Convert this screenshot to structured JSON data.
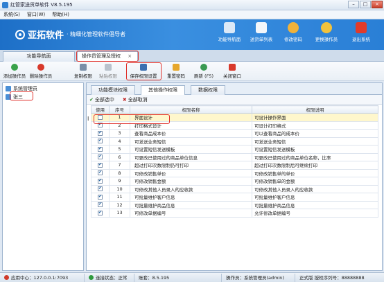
{
  "window": {
    "title": "红管家送货单软件 V8.5.195",
    "controls": [
      "–",
      "□",
      "×"
    ]
  },
  "menu": [
    "系统(S)",
    "窗口(W)",
    "帮助(H)"
  ],
  "banner": {
    "brand": "亚拓软件",
    "slogan": "· 精细化管理软件倡导者",
    "buttons": [
      {
        "label": "功能导航面",
        "icon": "monitor-icon",
        "color": "#dce9f7"
      },
      {
        "label": "送货单列表",
        "icon": "list-icon",
        "color": "#f3f6fa"
      },
      {
        "label": "修改密码",
        "icon": "user-key-icon",
        "color": "#f0b23a"
      },
      {
        "label": "更换操作员",
        "icon": "users-icon",
        "color": "#f2c23c"
      },
      {
        "label": "退出系统",
        "icon": "power-icon",
        "color": "#e23a2a"
      }
    ]
  },
  "tabs": [
    {
      "label": "功能导航面"
    },
    {
      "label": "操作员管理及授权",
      "close": "×"
    }
  ],
  "toolbar": [
    {
      "label": "添加操作员",
      "icon": "add-icon",
      "color": "#3aa24a",
      "enabled": true
    },
    {
      "label": "删除操作员",
      "icon": "delete-icon",
      "color": "#d8392b",
      "enabled": true
    },
    {
      "label": "复制权限",
      "icon": "copy-icon",
      "color": "#7a8fa8",
      "enabled": true
    },
    {
      "label": "粘贴权限",
      "icon": "paste-icon",
      "color": "#b9c2cc",
      "enabled": false
    },
    {
      "label": "保存权限设置",
      "icon": "save-icon",
      "color": "#3c6fb0",
      "enabled": true
    },
    {
      "label": "重置密码",
      "icon": "key-icon",
      "color": "#e6a72c",
      "enabled": true
    },
    {
      "label": "刷新 (F5)",
      "icon": "refresh-icon",
      "color": "#3a9a52",
      "enabled": true
    },
    {
      "label": "关闭窗口",
      "icon": "close-icon",
      "color": "#d8392b",
      "enabled": true
    }
  ],
  "tree": [
    "系统管理员",
    "张三"
  ],
  "subtabs": [
    "功能模块权限",
    "其他操作权限",
    "数据权限"
  ],
  "selbar": {
    "select_all": "全部选中",
    "clear_all": "全部取消"
  },
  "columns": [
    "使用",
    "序号",
    "权限名称",
    "权限说明"
  ],
  "rows": [
    {
      "checked": false,
      "no": "1",
      "name": "界面设计",
      "desc": "可设计操作界面"
    },
    {
      "checked": true,
      "no": "2",
      "name": "打印格式设计",
      "desc": "可设计打印格式"
    },
    {
      "checked": true,
      "no": "3",
      "name": "查看商品成本价",
      "desc": "可以查看商品的成本价"
    },
    {
      "checked": true,
      "no": "4",
      "name": "可发送业务短信",
      "desc": "可发送业务短信"
    },
    {
      "checked": true,
      "no": "5",
      "name": "可设置短信发送模板",
      "desc": "可设置短信发送模板"
    },
    {
      "checked": true,
      "no": "6",
      "name": "可更改已使用过的商品单位信息",
      "desc": "可更改已使用过的商品单位名称，比率"
    },
    {
      "checked": true,
      "no": "7",
      "name": "超过打印次数限制仍可打印",
      "desc": "超过打印次数限制后可继续打印"
    },
    {
      "checked": true,
      "no": "8",
      "name": "可修改销售单价",
      "desc": "可修改销售单的单价"
    },
    {
      "checked": true,
      "no": "9",
      "name": "可修改销售金额",
      "desc": "可修改销售单的金额"
    },
    {
      "checked": true,
      "no": "10",
      "name": "可修改其他人员录入的应收款",
      "desc": "可修改其他人员录入的应收款"
    },
    {
      "checked": true,
      "no": "11",
      "name": "可批量维护客户信息",
      "desc": "可批量维护客户信息"
    },
    {
      "checked": true,
      "no": "12",
      "name": "可批量维护商品信息",
      "desc": "可批量维护商品信息"
    },
    {
      "checked": true,
      "no": "13",
      "name": "可修改单据编号",
      "desc": "允许修改单据编号"
    }
  ],
  "cursor_mark": "I",
  "status": {
    "app_center": "应用中心：127.0.0.1:7093",
    "connection": "连接状态：正常",
    "account": "账套：8.5.195",
    "operator": "操作员：系统管理员(admin)",
    "license": "正式版 授权序列号：88888888"
  }
}
